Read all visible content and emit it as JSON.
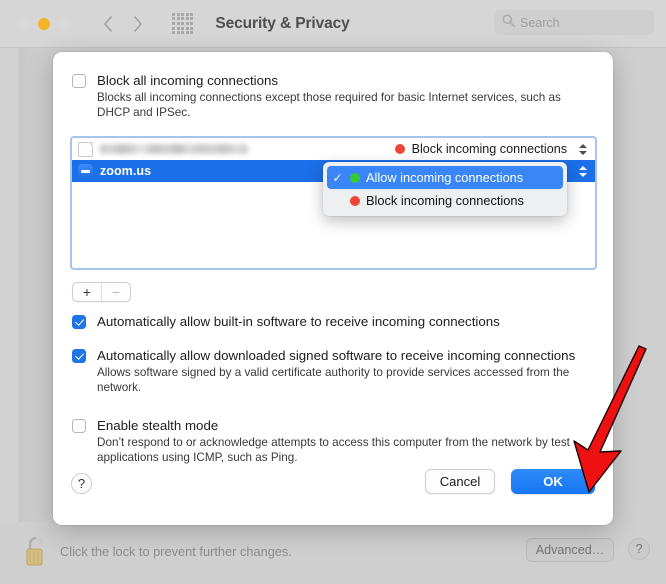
{
  "window": {
    "title": "Security & Privacy",
    "traffic_lights": [
      "close",
      "minimize",
      "maximize"
    ],
    "nav_back_icon": "chevron-left-icon",
    "nav_forward_icon": "chevron-right-icon",
    "grid_icon": "grid-view-icon",
    "search": {
      "placeholder": "Search",
      "icon": "search-icon",
      "value": ""
    }
  },
  "sheet": {
    "block_all": {
      "label": "Block all incoming connections",
      "checked": false,
      "description": "Blocks all incoming connections except those required for basic Internet services, such as DHCP and IPSec."
    },
    "app_list": {
      "rows": [
        {
          "name": "",
          "redacted": true,
          "icon": "generic-document-icon",
          "status": "Block incoming connections",
          "status_dot_color": "#f04438",
          "selected": false,
          "stepper_icon": "stepper-updown-icon"
        },
        {
          "name": "zoom.us",
          "redacted": false,
          "icon": "zoom-app-icon",
          "status": "Allow incoming connections",
          "status_dot_color": "#35c935",
          "selected": true,
          "stepper_icon": "stepper-updown-icon"
        }
      ]
    },
    "dropdown_menu": {
      "open": true,
      "items": [
        {
          "label": "Allow incoming connections",
          "dot_color": "#35c935",
          "checked": true,
          "active": true,
          "check_glyph": "✓"
        },
        {
          "label": "Block incoming connections",
          "dot_color": "#f04438",
          "checked": false,
          "active": false,
          "check_glyph": "✓"
        }
      ]
    },
    "list_buttons": {
      "add_label": "+",
      "remove_label": "−",
      "add_icon": "plus-icon",
      "remove_icon": "minus-icon"
    },
    "options": [
      {
        "label": "Automatically allow built-in software to receive incoming connections",
        "checked": true,
        "description": ""
      },
      {
        "label": "Automatically allow downloaded signed software to receive incoming connections",
        "checked": true,
        "description": "Allows software signed by a valid certificate authority to provide services accessed from the network."
      },
      {
        "label": "Enable stealth mode",
        "checked": false,
        "description": "Don’t respond to or acknowledge attempts to access this computer from the network by test applications using ICMP, such as Ping."
      }
    ],
    "footer": {
      "help_label": "?",
      "help_icon": "question-mark-icon",
      "cancel_label": "Cancel",
      "ok_label": "OK"
    }
  },
  "bottom_bar": {
    "lock_icon": "unlocked-padlock-icon",
    "lock_text": "Click the lock to prevent further changes.",
    "advanced_label": "Advanced…",
    "help_label": "?",
    "help_icon": "question-mark-icon"
  },
  "annotation": {
    "arrow_color": "#ee1111",
    "arrow_icon": "red-arrow-pointing-to-ok-button"
  },
  "colors": {
    "accent_blue": "#1577f2",
    "selection_blue": "#1b6fe8",
    "menu_active_blue": "#3a86f7",
    "status_green": "#35c935",
    "status_red": "#f04438",
    "window_bg": "#cfcfcf",
    "sheet_bg": "#ffffff"
  }
}
